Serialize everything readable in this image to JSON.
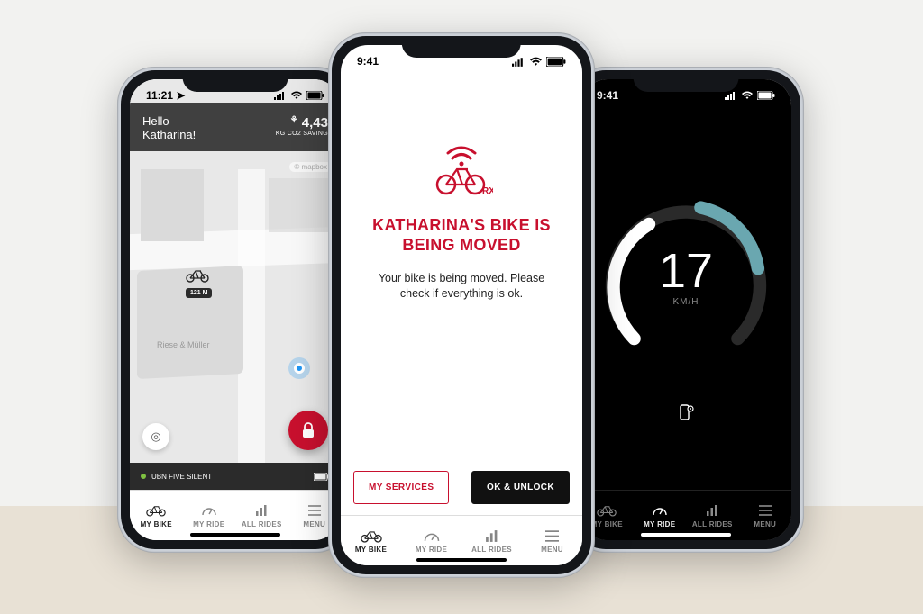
{
  "nav": {
    "items": [
      {
        "label": "MY BIKE"
      },
      {
        "label": "MY RIDE"
      },
      {
        "label": "ALL RIDES"
      },
      {
        "label": "MENU"
      }
    ]
  },
  "left": {
    "time": "11:21",
    "greeting_line1": "Hello",
    "greeting_line2": "Katharina!",
    "co2_value": "4,43",
    "co2_label": "KG CO2 SAVING",
    "map_attrib": "© mapbox",
    "bike_distance": "121 M",
    "poi_label": "Riese & Müller",
    "bike_name": "UBN FIVE SILENT",
    "active_tab": 0
  },
  "center": {
    "time": "9:41",
    "brand_suffix": "RX",
    "title_line1": "KATHARINA'S BIKE IS",
    "title_line2": "BEING MOVED",
    "message": "Your bike is being moved. Please check if everything is ok.",
    "btn_services": "MY SERVICES",
    "btn_ok": "OK & UNLOCK",
    "active_tab": 0
  },
  "right": {
    "time": "9:41",
    "speed_value": "17",
    "speed_unit": "KM/H",
    "active_tab": 1
  },
  "colors": {
    "accent": "#c8102e"
  }
}
